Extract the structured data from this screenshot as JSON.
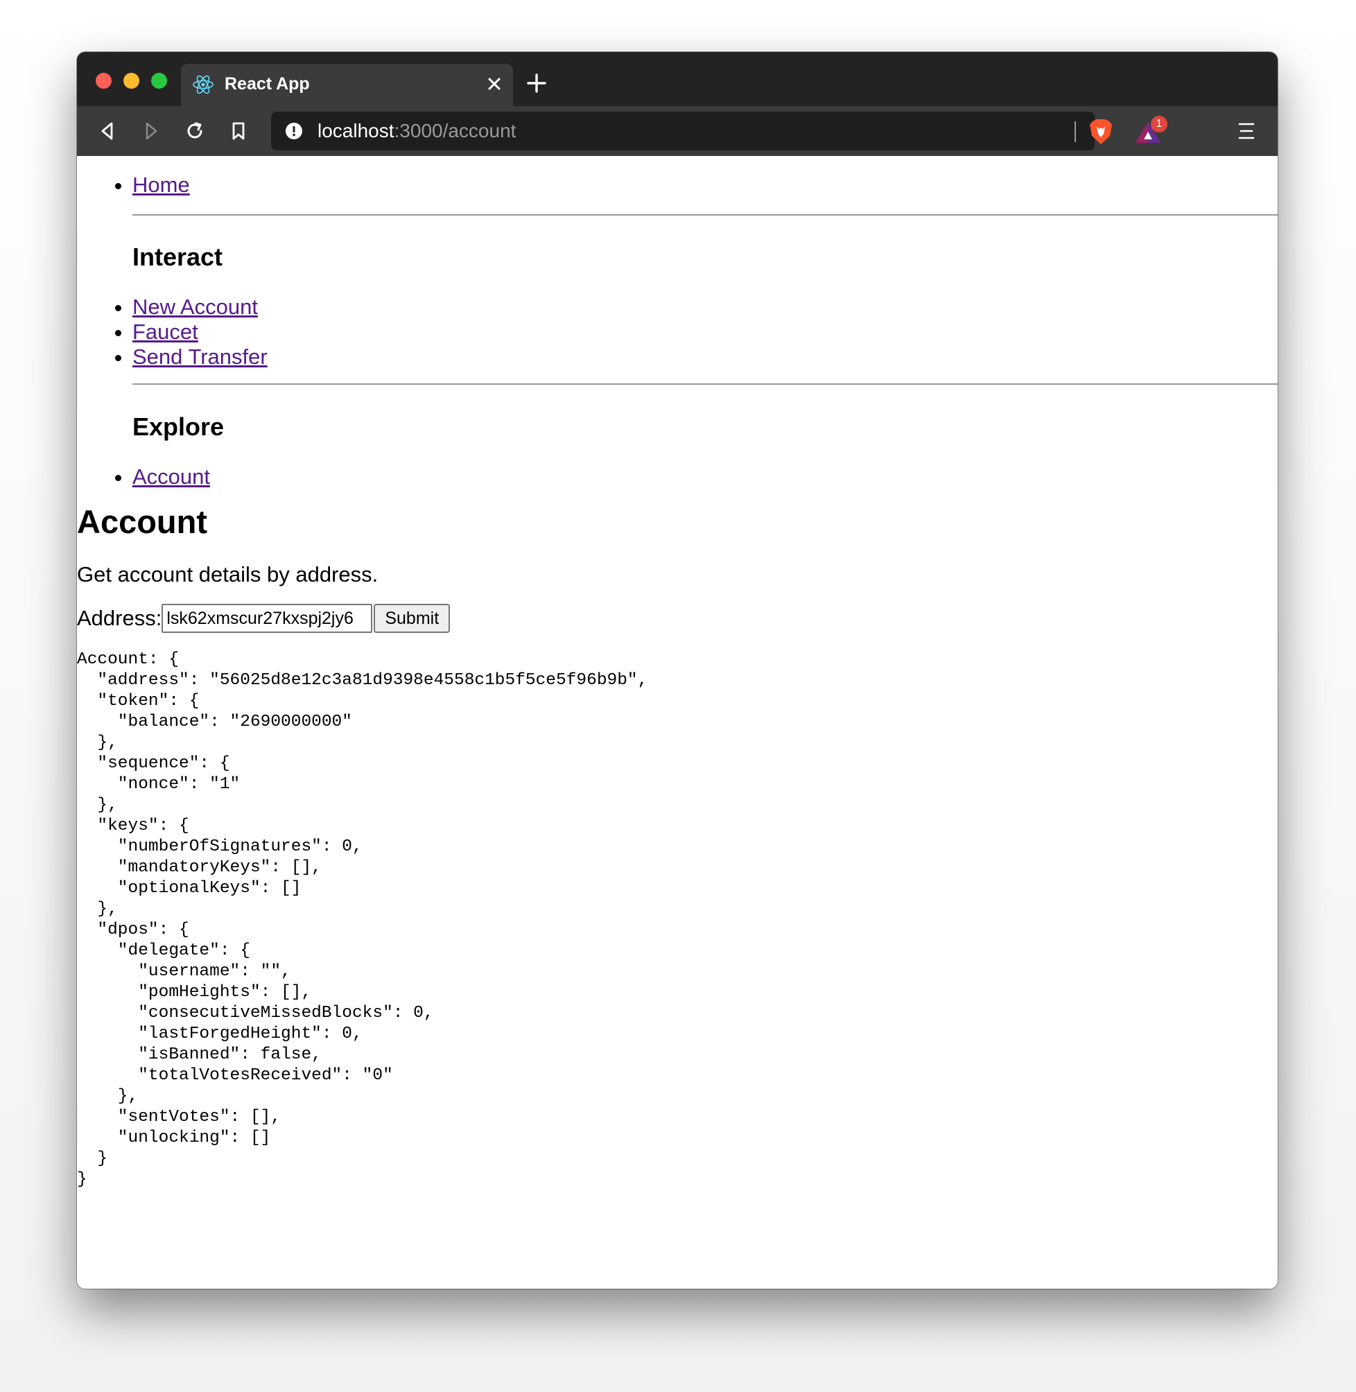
{
  "browser": {
    "tab_title": "React App",
    "url_host": "localhost",
    "url_path": ":3000/account",
    "rewards_count": "1"
  },
  "nav": {
    "home": "Home",
    "interact_heading": "Interact",
    "interact_links": [
      "New Account",
      "Faucet",
      "Send Transfer"
    ],
    "explore_heading": "Explore",
    "explore_links": [
      "Account"
    ]
  },
  "page": {
    "title": "Account",
    "description": "Get account details by address.",
    "address_label": "Address:",
    "address_value": "lsk62xmscur27kxspj2jy6",
    "submit_label": "Submit"
  },
  "result": {
    "text": "Account: {\n  \"address\": \"56025d8e12c3a81d9398e4558c1b5f5ce5f96b9b\",\n  \"token\": {\n    \"balance\": \"2690000000\"\n  },\n  \"sequence\": {\n    \"nonce\": \"1\"\n  },\n  \"keys\": {\n    \"numberOfSignatures\": 0,\n    \"mandatoryKeys\": [],\n    \"optionalKeys\": []\n  },\n  \"dpos\": {\n    \"delegate\": {\n      \"username\": \"\",\n      \"pomHeights\": [],\n      \"consecutiveMissedBlocks\": 0,\n      \"lastForgedHeight\": 0,\n      \"isBanned\": false,\n      \"totalVotesReceived\": \"0\"\n    },\n    \"sentVotes\": [],\n    \"unlocking\": []\n  }\n}"
  }
}
